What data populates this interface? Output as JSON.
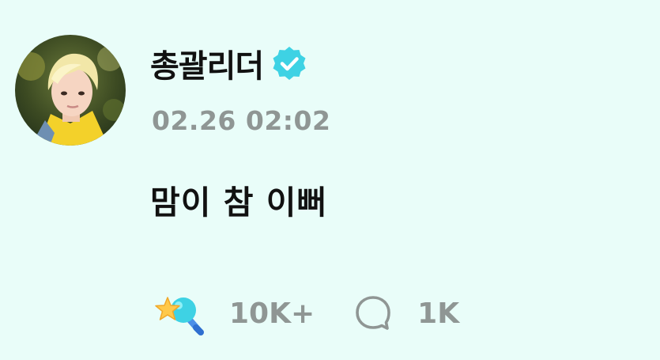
{
  "author": {
    "name": "총괄리더",
    "verified": true,
    "avatar_icon": "profile-photo"
  },
  "post": {
    "timestamp": "02.26 02:02",
    "text": "맘이 참 이뻐"
  },
  "actions": {
    "cheer_count": "10K+",
    "comment_count": "1K",
    "cheer_icon": "star-wand-icon",
    "comment_icon": "speech-bubble-icon"
  },
  "colors": {
    "background": "#e9fdf9",
    "verified_badge": "#3ed2e4",
    "muted_text": "#8f9694",
    "primary_text": "#111111"
  }
}
